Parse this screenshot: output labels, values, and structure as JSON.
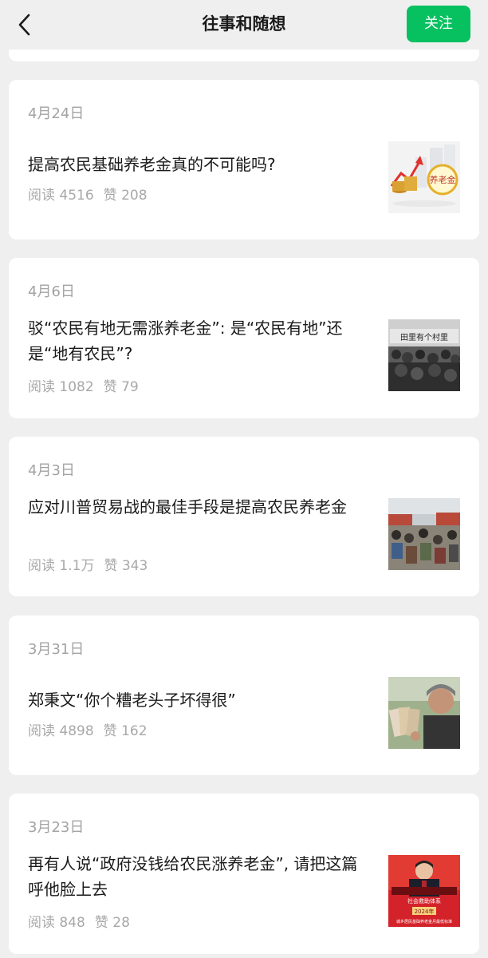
{
  "header": {
    "title": "往事和随想",
    "follow_label": "关注"
  },
  "articles": [
    {
      "date": "4月24日",
      "title": "提高农民基础养老金真的不可能吗?",
      "reads_label": "阅读 4516",
      "likes_label": "赞 208",
      "thumb_text": "养老金"
    },
    {
      "date": "4月6日",
      "title": "驳“农民有地无需涨养老金”: 是“农民有地”还是“地有农民”?",
      "reads_label": "阅读 1082",
      "likes_label": "赞 79",
      "thumb_text": "田里有个村里"
    },
    {
      "date": "4月3日",
      "title": "应对川普贸易战的最佳手段是提高农民养老金",
      "reads_label": "阅读 1.1万",
      "likes_label": "赞 343"
    },
    {
      "date": "3月31日",
      "title": "郑秉文“你个糟老头子坏得很”",
      "reads_label": "阅读 4898",
      "likes_label": "赞 162"
    },
    {
      "date": "3月23日",
      "title": "再有人说“政府没钱给农民涨养老金”, 请把这篇呼他脸上去",
      "reads_label": "阅读 848",
      "likes_label": "赞 28",
      "thumb_text_1": "社会救助体系",
      "thumb_text_2": "2024年",
      "thumb_text_3": "城乡居民基础养老金月最低标准"
    }
  ],
  "colors": {
    "page_bg": "#efefef",
    "card_bg": "#ffffff",
    "accent": "#07c160",
    "meta": "#a8a8a8"
  },
  "icons": {
    "back": "chevron-left-icon"
  }
}
